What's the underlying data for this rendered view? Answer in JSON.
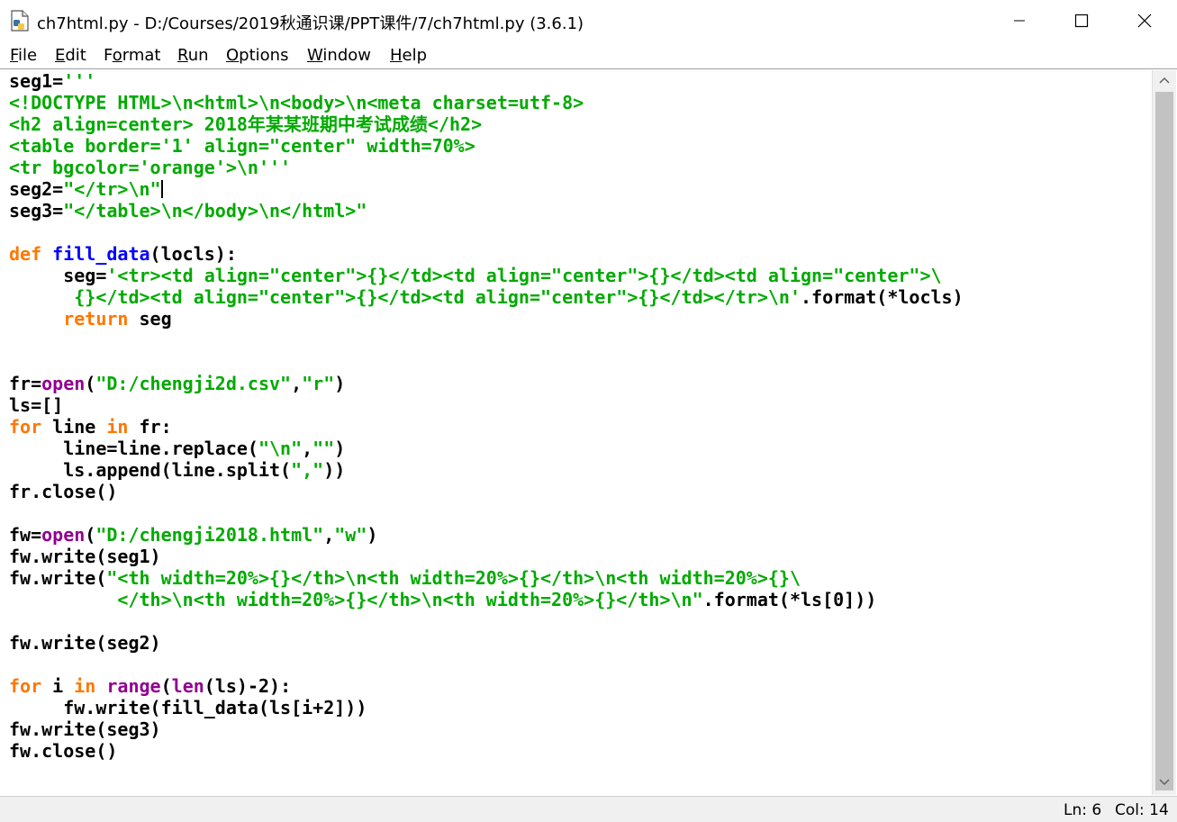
{
  "window": {
    "title": "ch7html.py - D:/Courses/2019秋通识课/PPT课件/7/ch7html.py (3.6.1)"
  },
  "menu": [
    {
      "label": "File",
      "u": "F",
      "rest": "ile"
    },
    {
      "label": "Edit",
      "u": "E",
      "rest": "dit"
    },
    {
      "label": "Format",
      "pre": "F",
      "u": "o",
      "rest": "rmat"
    },
    {
      "label": "Run",
      "u": "R",
      "rest": "un"
    },
    {
      "label": "Options",
      "u": "O",
      "rest": "ptions"
    },
    {
      "label": "Window",
      "u": "W",
      "rest": "indow"
    },
    {
      "label": "Help",
      "u": "H",
      "rest": "elp"
    }
  ],
  "status": {
    "ln": "Ln: 6",
    "col": "Col: 14"
  },
  "colors": {
    "keyword": "#ff7700",
    "builtin": "#900090",
    "string": "#00aa00",
    "definition": "#0000ff",
    "default": "#000000"
  },
  "code_lines": [
    [
      [
        "d",
        "seg1="
      ],
      [
        "st",
        "'''"
      ]
    ],
    [
      [
        "st",
        "<!DOCTYPE HTML>\\n<html>\\n<body>\\n<meta charset=utf-8>"
      ]
    ],
    [
      [
        "st",
        "<h2 align=center> 2018年某某班期中考试成绩</h2>"
      ]
    ],
    [
      [
        "st",
        "<table border='1' align=\"center\" width=70%>"
      ]
    ],
    [
      [
        "st",
        "<tr bgcolor='orange'>\\n'''"
      ]
    ],
    [
      [
        "d",
        "seg2="
      ],
      [
        "st",
        "\"</tr>\\n\""
      ],
      [
        "cursor",
        ""
      ]
    ],
    [
      [
        "d",
        "seg3="
      ],
      [
        "st",
        "\"</table>\\n</body>\\n</html>\""
      ]
    ],
    [],
    [
      [
        "kw",
        "def "
      ],
      [
        "df",
        "fill_data"
      ],
      [
        "d",
        "(locls):"
      ]
    ],
    [
      [
        "d",
        "     seg="
      ],
      [
        "st",
        "'<tr><td align=\"center\">{}</td><td align=\"center\">{}</td><td align=\"center\">\\"
      ]
    ],
    [
      [
        "st",
        "      {}</td><td align=\"center\">{}</td><td align=\"center\">{}</td></tr>\\n'"
      ],
      [
        "d",
        ".format(*locls)"
      ]
    ],
    [
      [
        "kw",
        "     return"
      ],
      [
        "d",
        " seg"
      ]
    ],
    [],
    [],
    [
      [
        "d",
        "fr="
      ],
      [
        "bi",
        "open"
      ],
      [
        "d",
        "("
      ],
      [
        "st",
        "\"D:/chengji2d.csv\""
      ],
      [
        "d",
        ","
      ],
      [
        "st",
        "\"r\""
      ],
      [
        "d",
        ")"
      ]
    ],
    [
      [
        "d",
        "ls=[]"
      ]
    ],
    [
      [
        "kw",
        "for"
      ],
      [
        "d",
        " line "
      ],
      [
        "kw",
        "in"
      ],
      [
        "d",
        " fr:"
      ]
    ],
    [
      [
        "d",
        "     line=line.replace("
      ],
      [
        "st",
        "\"\\n\""
      ],
      [
        "d",
        ","
      ],
      [
        "st",
        "\"\""
      ],
      [
        "d",
        ")"
      ]
    ],
    [
      [
        "d",
        "     ls.append(line.split("
      ],
      [
        "st",
        "\",\""
      ],
      [
        "d",
        "))"
      ]
    ],
    [
      [
        "d",
        "fr.close()"
      ]
    ],
    [],
    [
      [
        "d",
        "fw="
      ],
      [
        "bi",
        "open"
      ],
      [
        "d",
        "("
      ],
      [
        "st",
        "\"D:/chengji2018.html\""
      ],
      [
        "d",
        ","
      ],
      [
        "st",
        "\"w\""
      ],
      [
        "d",
        ")"
      ]
    ],
    [
      [
        "d",
        "fw.write(seg1)"
      ]
    ],
    [
      [
        "d",
        "fw.write("
      ],
      [
        "st",
        "\"<th width=20%>{}</th>\\n<th width=20%>{}</th>\\n<th width=20%>{}\\"
      ]
    ],
    [
      [
        "st",
        "          </th>\\n<th width=20%>{}</th>\\n<th width=20%>{}</th>\\n\""
      ],
      [
        "d",
        ".format(*ls[0]))"
      ]
    ],
    [],
    [
      [
        "d",
        "fw.write(seg2)"
      ]
    ],
    [],
    [
      [
        "kw",
        "for"
      ],
      [
        "d",
        " i "
      ],
      [
        "kw",
        "in"
      ],
      [
        "d",
        " "
      ],
      [
        "bi",
        "range"
      ],
      [
        "d",
        "("
      ],
      [
        "bi",
        "len"
      ],
      [
        "d",
        "(ls)-2):"
      ]
    ],
    [
      [
        "d",
        "     fw.write(fill_data(ls[i+2]))"
      ]
    ],
    [
      [
        "d",
        "fw.write(seg3)"
      ]
    ],
    [
      [
        "d",
        "fw.close()"
      ]
    ]
  ]
}
